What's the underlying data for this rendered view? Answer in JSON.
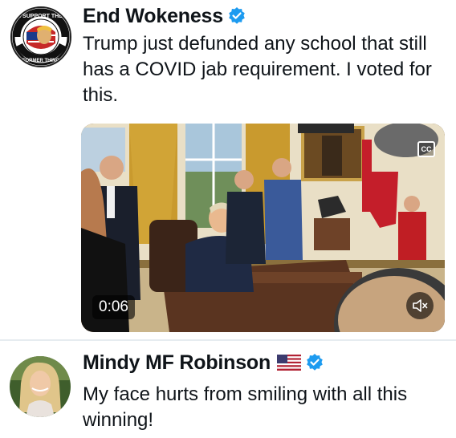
{
  "posts": [
    {
      "author": "End Wokeness",
      "verified": true,
      "avatar_label": "I SUPPORT THE FORMER THING",
      "text": "Trump just defunded any school that still has a COVID jab requirement. I voted for this.",
      "video": {
        "duration": "0:06",
        "cc_label": "CC",
        "muted_icon": "speaker-muted-icon"
      }
    },
    {
      "author": "Mindy MF Robinson",
      "verified": true,
      "flag_icon": "us-flag-icon",
      "text": "My face hurts from smiling with all this winning!"
    }
  ],
  "colors": {
    "verified_blue": "#1d9bf0",
    "text": "#0f1419",
    "divider": "#e6ecf0"
  }
}
